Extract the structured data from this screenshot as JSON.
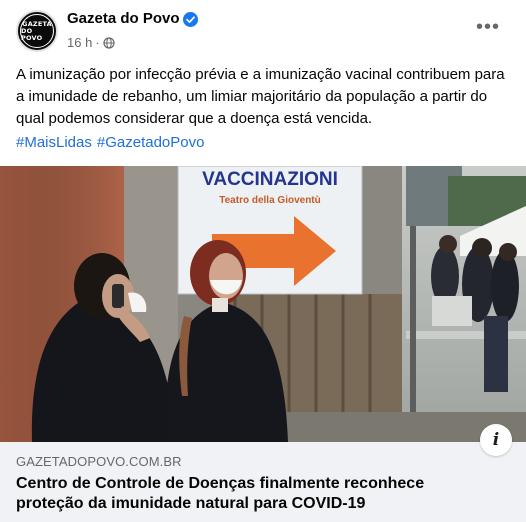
{
  "page": {
    "name": "Gazeta do Povo",
    "avatar_text": [
      "GAZETA",
      "DO POVO"
    ],
    "timestamp": "16 h",
    "separator": "·",
    "more_icon": "more-icon",
    "verified_icon": "verified-badge-icon",
    "audience_icon": "globe-icon"
  },
  "post": {
    "text": "A imunização por infecção prévia e a imunização vacinal contribuem para a imunidade de rebanho, um limiar majoritário da população a partir do qual podemos considerar que a doença está vencida.",
    "hashtags": [
      "#MaisLidas",
      "#GazetadoPovo"
    ]
  },
  "photo": {
    "sign_title": "VACCINAZIONI",
    "sign_subtitle": "Teatro della Gioventù"
  },
  "link": {
    "domain": "GAZETADOPOVO.COM.BR",
    "title": "Centro de Controle de Doenças finalmente reconhece proteção da imunidade natural para COVID-19",
    "info_glyph": "i"
  },
  "colors": {
    "link_blue": "#216fdb",
    "verified_blue": "#1877f2",
    "card_bg": "#f0f2f5",
    "muted": "#65676b"
  }
}
